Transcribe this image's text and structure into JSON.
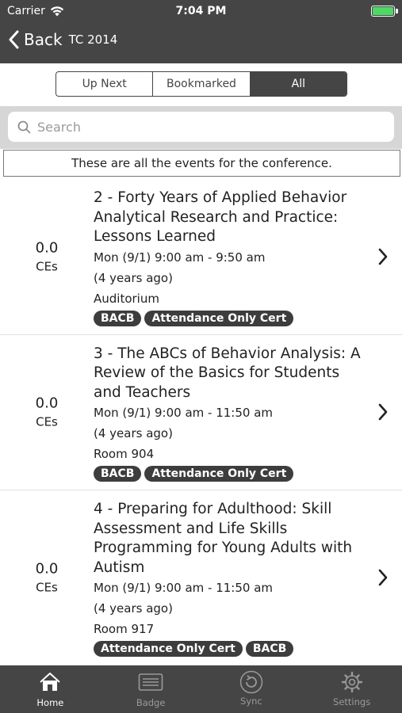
{
  "status_bar": {
    "carrier": "Carrier",
    "time": "7:04 PM",
    "battery_level": 1.0
  },
  "nav": {
    "back_label": "Back",
    "title": "TC 2014"
  },
  "segments": [
    {
      "label": "Up Next",
      "active": false
    },
    {
      "label": "Bookmarked",
      "active": false
    },
    {
      "label": "All",
      "active": true
    }
  ],
  "search": {
    "placeholder": "Search",
    "value": ""
  },
  "banner": "These are all the events for the conference.",
  "events": [
    {
      "ce_value": "0.0",
      "ce_label": "CEs",
      "title": "2 - Forty Years of Applied Behavior Analytical Research and Practice: Lessons Learned",
      "time": "Mon (9/1) 9:00 am - 9:50 am",
      "relative": "(4 years ago)",
      "room": "Auditorium",
      "tags": [
        "BACB",
        "Attendance Only Cert"
      ]
    },
    {
      "ce_value": "0.0",
      "ce_label": "CEs",
      "title": "3 - The ABCs of Behavior Analysis: A Review of the Basics for Students and Teachers",
      "time": "Mon (9/1) 9:00 am - 11:50 am",
      "relative": "(4 years ago)",
      "room": "Room 904",
      "tags": [
        "BACB",
        "Attendance Only Cert"
      ]
    },
    {
      "ce_value": "0.0",
      "ce_label": "CEs",
      "title": "4 - Preparing for Adulthood: Skill Assessment and Life Skills Programming for Young Adults with Autism",
      "time": "Mon (9/1) 9:00 am - 11:50 am",
      "relative": "(4 years ago)",
      "room": "Room 917",
      "tags": [
        "Attendance Only Cert",
        "BACB"
      ]
    }
  ],
  "tabs": [
    {
      "label": "Home",
      "icon": "home-icon",
      "active": true
    },
    {
      "label": "Badge",
      "icon": "badge-icon",
      "active": false
    },
    {
      "label": "Sync",
      "icon": "sync-icon",
      "active": false
    },
    {
      "label": "Settings",
      "icon": "settings-icon",
      "active": false
    }
  ],
  "colors": {
    "header": "#454545",
    "active_tag": "#3d3d3d",
    "battery": "#4cd964"
  }
}
